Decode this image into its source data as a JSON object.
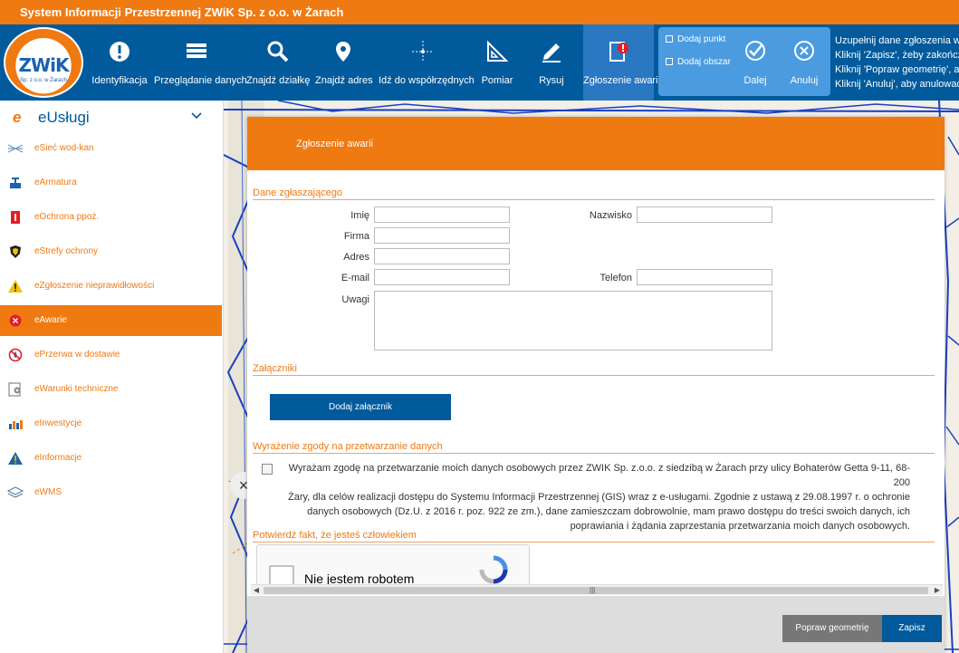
{
  "app": {
    "title": "System Informacji Przestrzennej ZWiK Sp. z o.o. w Żarach"
  },
  "logo": {
    "text": "ZWiK",
    "subtitle": "Sp. z o.o. w Żarach"
  },
  "toolbar": {
    "tools": [
      {
        "label": "Identyfikacja",
        "icon": "info-icon"
      },
      {
        "label": "Przeglądanie danych",
        "icon": "table-icon"
      },
      {
        "label": "Znajdź działkę",
        "icon": "search-icon"
      },
      {
        "label": "Znajdź adres",
        "icon": "map-pin-icon"
      },
      {
        "label": "Idź do współrzędnych",
        "icon": "crosshair-icon"
      },
      {
        "label": "Pomiar",
        "icon": "ruler-icon"
      },
      {
        "label": "Rysuj",
        "icon": "pencil-icon"
      },
      {
        "label": "Zgłoszenie awarii",
        "icon": "alert-report-icon"
      }
    ],
    "selection": {
      "add_point": "Dodaj punkt",
      "add_area": "Dodaj obszar",
      "next": "Dalej",
      "cancel": "Anuluj"
    },
    "info_lines": [
      "Uzupełnij dane zgłoszenia w",
      "Kliknij 'Zapisz', żeby zakończ",
      "Kliknij 'Popraw geometrię', ab",
      "Kliknij 'Anuluj', aby anulować"
    ]
  },
  "sidebar": {
    "title_prefix": "e",
    "title": "eUsługi",
    "items": [
      {
        "label": "eSieć wod-kan",
        "icon": "network-icon"
      },
      {
        "label": "eArmatura",
        "icon": "valve-icon"
      },
      {
        "label": "eOchrona ppoż.",
        "icon": "fire-hydrant-icon"
      },
      {
        "label": "eStrefy ochrony",
        "icon": "shield-icon"
      },
      {
        "label": "eZgłoszenie nieprawidłowości",
        "icon": "warning-icon"
      },
      {
        "label": "eAwarie",
        "icon": "failure-icon"
      },
      {
        "label": "ePrzerwa w dostawie",
        "icon": "supply-break-icon"
      },
      {
        "label": "eWarunki techniczne",
        "icon": "gear-doc-icon"
      },
      {
        "label": "eInwestycje",
        "icon": "bar-chart-icon"
      },
      {
        "label": "eInformacje",
        "icon": "info-warning-icon"
      },
      {
        "label": "eWMS",
        "icon": "layers-icon"
      }
    ],
    "active_index": 5
  },
  "dialog": {
    "title": "Zgłoszenie awarii",
    "section_reporter": "Dane zgłaszającego",
    "fields": {
      "first_name": "Imię",
      "last_name": "Nazwisko",
      "company": "Firma",
      "address": "Adres",
      "email": "E-mail",
      "phone": "Telefon",
      "notes": "Uwagi"
    },
    "section_attachments": "Załączniki",
    "add_attachment": "Dodaj załącznik",
    "section_consent": "Wyrażenie zgody na przetwarzanie danych",
    "consent_lines": [
      "Wyrażam zgodę na przetwarzanie moich danych osobowych przez ZWIK Sp. z.o.o. z siedzibą w Żarach przy ulicy Bohaterów Getta 9-11, 68-200",
      "Żary, dla celów realizacji dostępu do Systemu Informacji Przestrzennej (GIS) wraz z e-usługami. Zgodnie z ustawą z 29.08.1997 r. o ochronie",
      "danych osobowych (Dz.U. z 2016 r. poz. 922 ze zm.), dane zamieszczam dobrowolnie, mam prawo dostępu do treści swoich danych, ich",
      "poprawiania i żądania zaprzestania przetwarzania moich danych osobowych."
    ],
    "section_captcha": "Potwierdź fakt, że jesteś człowiekiem",
    "captcha_label": "Nie jestem robotem",
    "buttons": {
      "fix_geometry": "Popraw geometrię",
      "save": "Zapisz"
    }
  },
  "colors": {
    "orange": "#ef7a12",
    "blue": "#005a9c",
    "light_blue": "#4a9be0"
  }
}
